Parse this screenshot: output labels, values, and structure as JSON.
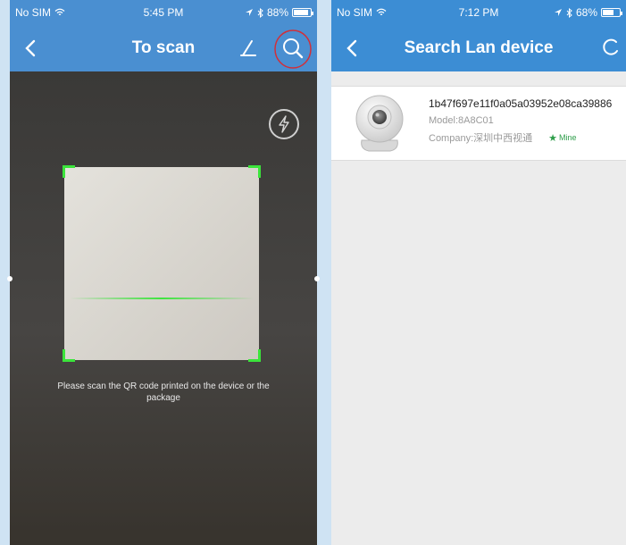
{
  "left_screen": {
    "status": {
      "carrier": "No SIM",
      "time": "5:45 PM",
      "battery": "88%",
      "battery_level": 0.88
    },
    "nav": {
      "title": "To scan"
    },
    "hint": "Please scan the QR code printed on the device or the package",
    "icons": {
      "back": "chevron-left-icon",
      "draw": "pen-icon",
      "search": "search-icon",
      "flash": "flash-icon"
    },
    "colors": {
      "navbar": "#4a8fd1",
      "scan_corner": "#3be43b",
      "highlight_circle": "#d0303a"
    }
  },
  "right_screen": {
    "status": {
      "carrier": "No SIM",
      "time": "7:12 PM",
      "battery": "68%",
      "battery_level": 0.68
    },
    "nav": {
      "title": "Search Lan device"
    },
    "device": {
      "id": "1b47f697e11f0a05a03952e08ca39886",
      "model": "Model:8A8C01",
      "company": "Company:深圳中西视通",
      "badge": "Mine"
    },
    "icons": {
      "back": "chevron-left-icon",
      "refresh": "refresh-icon",
      "camera": "camera-icon",
      "star": "star-icon"
    },
    "colors": {
      "navbar": "#3c8dd4",
      "badge": "#2e9e4a"
    }
  }
}
